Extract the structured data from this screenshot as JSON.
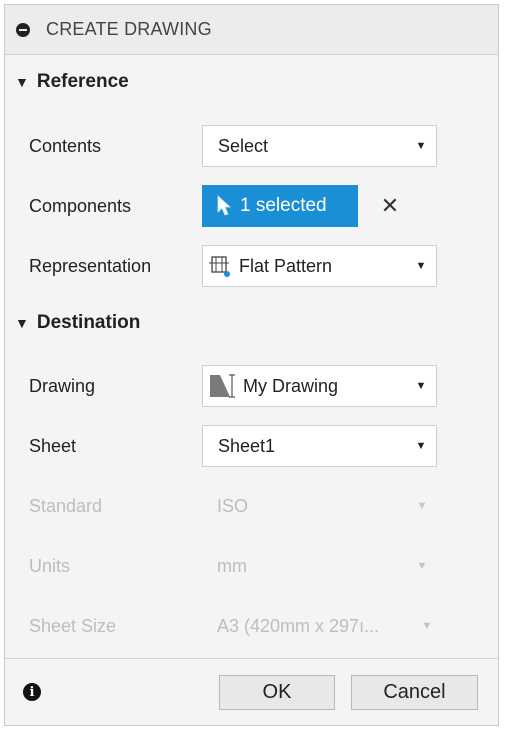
{
  "dialog": {
    "title": "CREATE DRAWING",
    "icons": {
      "collapse": "collapse-minus-icon",
      "info": "info-icon"
    }
  },
  "reference": {
    "header": "Reference",
    "contents": {
      "label": "Contents",
      "value": "Select"
    },
    "components": {
      "label": "Components",
      "value": "1 selected",
      "clear": "✕"
    },
    "representation": {
      "label": "Representation",
      "value": "Flat Pattern",
      "icon": "flat-pattern-icon"
    }
  },
  "destination": {
    "header": "Destination",
    "drawing": {
      "label": "Drawing",
      "value": "My Drawing",
      "icon": "drawing-icon"
    },
    "sheet": {
      "label": "Sheet",
      "value": "Sheet1"
    },
    "standard": {
      "label": "Standard",
      "value": "ISO"
    },
    "units": {
      "label": "Units",
      "value": "mm"
    },
    "sheet_size": {
      "label": "Sheet Size",
      "value": "A3 (420mm x 297ı..."
    }
  },
  "footer": {
    "ok": "OK",
    "cancel": "Cancel"
  },
  "colors": {
    "accent": "#1a8fd6",
    "disabled_text": "#bdbdbd"
  }
}
